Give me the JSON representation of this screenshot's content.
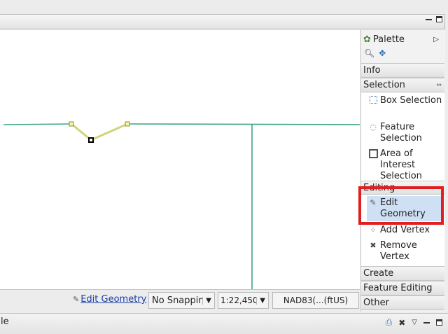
{
  "palette": {
    "title": "Palette",
    "info": "Info",
    "selection": {
      "title": "Selection",
      "tools": [
        {
          "label": "Box Selection",
          "icon": "box-select-icon"
        },
        {
          "label": "Feature Selection",
          "icon": "lasso-icon"
        },
        {
          "label": "Area of Interest Selection",
          "icon": "aoi-icon"
        }
      ]
    },
    "editing": {
      "title": "Editing",
      "tools": [
        {
          "label": "Edit Geometry",
          "icon": "edit-geometry-icon"
        },
        {
          "label": "Add Vertex",
          "icon": "add-vertex-icon"
        },
        {
          "label": "Remove Vertex",
          "icon": "remove-vertex-icon"
        }
      ]
    },
    "drawers": [
      "Create",
      "Feature Editing",
      "Other"
    ]
  },
  "status": {
    "tool_link": "Edit Geometry",
    "snapping": "No Snappin",
    "scale": "1:22,450",
    "crs": "NAD83(...(ftUS)"
  },
  "bottom": {
    "left_text": "le"
  },
  "colors": {
    "highlight": "#e02020",
    "line": "#3ea67e",
    "edit_segment": "#d1d47a",
    "selected_tool_bg": "#cfe0f4"
  }
}
